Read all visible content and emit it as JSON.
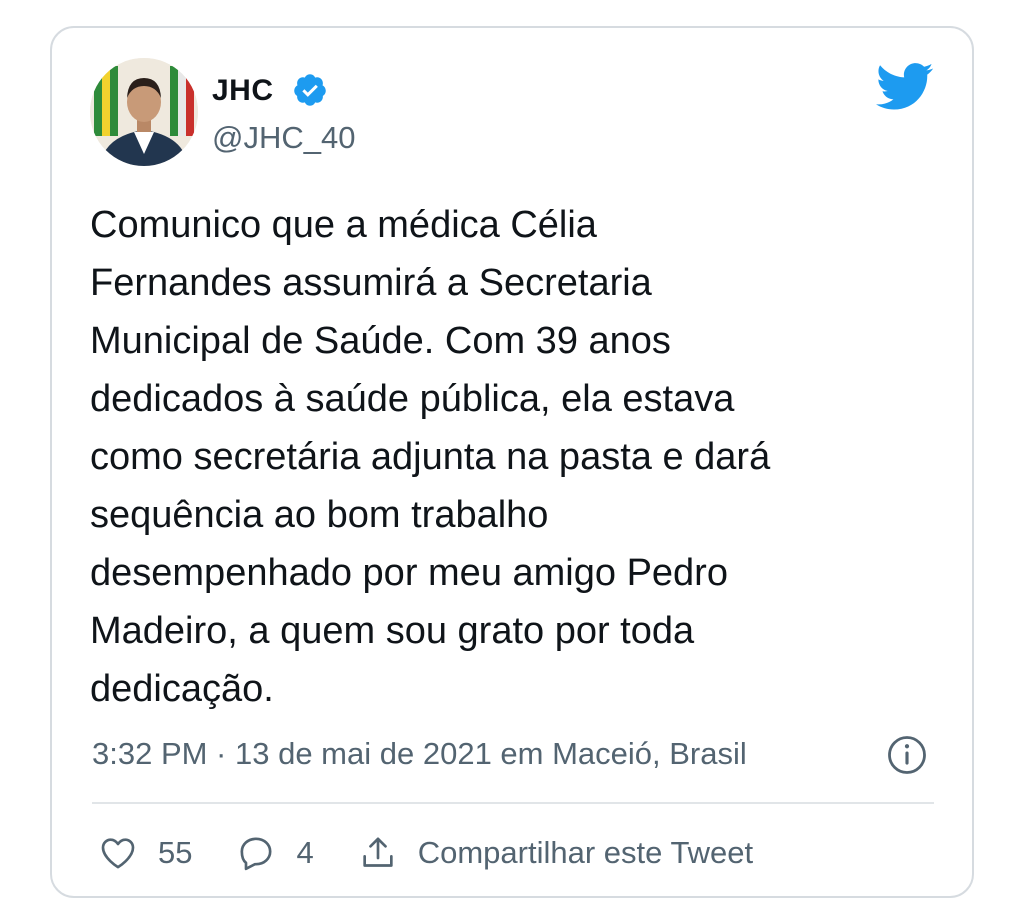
{
  "author": {
    "name": "JHC",
    "handle": "@JHC_40",
    "avatar_icon": "profile-photo",
    "verified": true
  },
  "brand": {
    "icon": "twitter-bird-icon",
    "color": "#1d9bf0"
  },
  "tweet": {
    "text": "Comunico que a médica Célia\nFernandes assumirá a Secretaria\nMunicipal de Saúde. Com 39 anos\ndedicados à saúde pública, ela estava\ncomo secretária adjunta na pasta e dará\nsequência ao bom trabalho\ndesempenhado por meu amigo Pedro\nMadeiro, a quem sou grato por toda\ndedicação."
  },
  "meta": {
    "line": "3:32 PM · 13 de mai de 2021 em Maceió, Brasil",
    "info_icon": "info-icon"
  },
  "actions": {
    "likes": "55",
    "replies": "4",
    "share_label": "Compartilhar este Tweet"
  },
  "colors": {
    "text": "#0f1419",
    "secondary": "#536471",
    "border": "#d6dbe0"
  }
}
